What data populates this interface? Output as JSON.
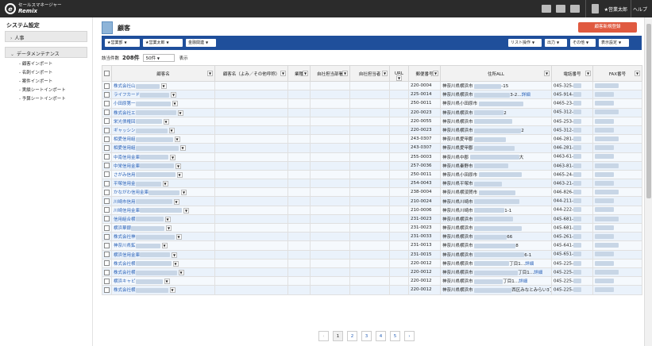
{
  "topbar": {
    "logo_line1": "セールスマネージャー",
    "logo_line2": "Remix",
    "user": "★営業太郎",
    "help": "ヘルプ"
  },
  "sidebar": {
    "title": "システム設定",
    "groups": [
      {
        "label": "人事"
      },
      {
        "label": "データメンテナンス"
      }
    ],
    "items": [
      {
        "label": "- 顧客インポート"
      },
      {
        "label": "- 名刺インポート"
      },
      {
        "label": "- 案件インポート"
      },
      {
        "label": "- 実績シートインポート"
      },
      {
        "label": "- 予算シートインポート"
      }
    ]
  },
  "page": {
    "title": "顧客",
    "new_button": "顧客新規登録"
  },
  "filters": {
    "left": [
      "★営業部",
      "★営業太郎",
      "金融関連"
    ],
    "right": [
      "リスト操作",
      "出力",
      "その他",
      "表示設定"
    ]
  },
  "count": {
    "label": "該当件数",
    "value": "208件",
    "per_page": "50件",
    "display": "表示"
  },
  "table": {
    "headers": [
      "顧客名",
      "顧客名（よみ／その他呼称）",
      "業種",
      "自社担当部署",
      "自社担当者",
      "URL",
      "郵便番号",
      "住所ALL",
      "電話番号",
      "FAX番号"
    ],
    "rows": [
      {
        "name": "株式会社山",
        "zip": "220-0004",
        "addr": "神奈川県横浜市",
        "addr_tail": "-15",
        "phone": "045-325-",
        "detail": ""
      },
      {
        "name": "ライフカード",
        "zip": "225-0014",
        "addr": "神奈川県横浜市",
        "addr_tail": "3-2…",
        "phone": "045-914-",
        "detail": "詳細"
      },
      {
        "name": "小田原第一",
        "zip": "250-0011",
        "addr": "神奈川県小田原市",
        "addr_tail": "",
        "phone": "0465-23-",
        "detail": ""
      },
      {
        "name": "株式会社エ",
        "zip": "220-0023",
        "addr": "神奈川県横浜市",
        "addr_tail": "2",
        "phone": "045-312-",
        "detail": ""
      },
      {
        "name": "栄光債権回",
        "zip": "220-0055",
        "addr": "神奈川県横浜市",
        "addr_tail": "",
        "phone": "045-253-",
        "detail": ""
      },
      {
        "name": "ギャッシン",
        "zip": "220-0023",
        "addr": "神奈川県横浜市",
        "addr_tail": "2",
        "phone": "045-312-",
        "detail": ""
      },
      {
        "name": "相愛信用組",
        "zip": "243-0307",
        "addr": "神奈川県愛甲郡",
        "addr_tail": "",
        "phone": "046-281-",
        "detail": ""
      },
      {
        "name": "相愛信用組",
        "zip": "243-0307",
        "addr": "神奈川県愛甲郡",
        "addr_tail": "",
        "phone": "046-281-",
        "detail": ""
      },
      {
        "name": "中南信用金庫",
        "zip": "255-0003",
        "addr": "神奈川県中郡",
        "addr_tail": "大",
        "phone": "0463-61-",
        "detail": ""
      },
      {
        "name": "中栄信用金庫",
        "zip": "257-0036",
        "addr": "神奈川県秦野市",
        "addr_tail": "",
        "phone": "0463-81-",
        "detail": ""
      },
      {
        "name": "さがみ信用",
        "zip": "250-0011",
        "addr": "神奈川県小田原市",
        "addr_tail": "",
        "phone": "0465-24-",
        "detail": ""
      },
      {
        "name": "平塚信用金",
        "zip": "254-0043",
        "addr": "神奈川県平塚市",
        "addr_tail": "",
        "phone": "0463-21-",
        "detail": ""
      },
      {
        "name": "かながわ信用金庫",
        "zip": "238-0004",
        "addr": "神奈川県横須賀市",
        "addr_tail": "",
        "phone": "046-826-",
        "detail": ""
      },
      {
        "name": "川崎市信用",
        "zip": "210-0024",
        "addr": "神奈川県川崎市",
        "addr_tail": "",
        "phone": "044-211-",
        "detail": ""
      },
      {
        "name": "川崎信用金庫",
        "zip": "210-0006",
        "addr": "神奈川県川崎市",
        "addr_tail": "1-1",
        "phone": "044-222-",
        "detail": ""
      },
      {
        "name": "信用組合横",
        "zip": "231-0023",
        "addr": "神奈川県横浜市",
        "addr_tail": "",
        "phone": "045-681-",
        "detail": ""
      },
      {
        "name": "横浜華銀",
        "zip": "231-0023",
        "addr": "神奈川県横浜市",
        "addr_tail": "",
        "phone": "045-681-",
        "detail": ""
      },
      {
        "name": "株式会社神",
        "zip": "231-0033",
        "addr": "神奈川県横浜市",
        "addr_tail": "66",
        "phone": "045-261-",
        "detail": ""
      },
      {
        "name": "神奈川県鉱",
        "zip": "231-0013",
        "addr": "神奈川県横浜市",
        "addr_tail": "8",
        "phone": "045-641-",
        "detail": ""
      },
      {
        "name": "横浜信用金庫",
        "zip": "231-0015",
        "addr": "神奈川県横浜市",
        "addr_tail": "6-1",
        "phone": "045-651-",
        "detail": ""
      },
      {
        "name": "株式会社横",
        "zip": "220-0012",
        "addr": "神奈川県横浜市",
        "addr_tail": "丁目1…",
        "phone": "045-225-",
        "detail": "詳細"
      },
      {
        "name": "株式会社横",
        "zip": "220-0012",
        "addr": "神奈川県横浜市",
        "addr_tail": "丁目1…",
        "phone": "045-225-",
        "detail": "詳細"
      },
      {
        "name": "横浜キャピ",
        "zip": "220-0012",
        "addr": "神奈川県横浜市",
        "addr_tail": "丁目1…",
        "phone": "045-225-",
        "detail": "詳細"
      },
      {
        "name": "株式会社横",
        "zip": "220-0012",
        "addr": "神奈川県横浜市",
        "addr_tail": "西区みなとみらい3丁目1…",
        "phone": "045-225-",
        "detail": "詳細"
      }
    ]
  },
  "pager": {
    "prev": "‹",
    "pages": [
      "1",
      "2",
      "3",
      "4",
      "5"
    ],
    "next": "›"
  },
  "colors": {
    "topbar": "#2b2b2b",
    "filterbar": "#1f4f9b",
    "new_button": "#e05a40",
    "link": "#2a62b8"
  }
}
